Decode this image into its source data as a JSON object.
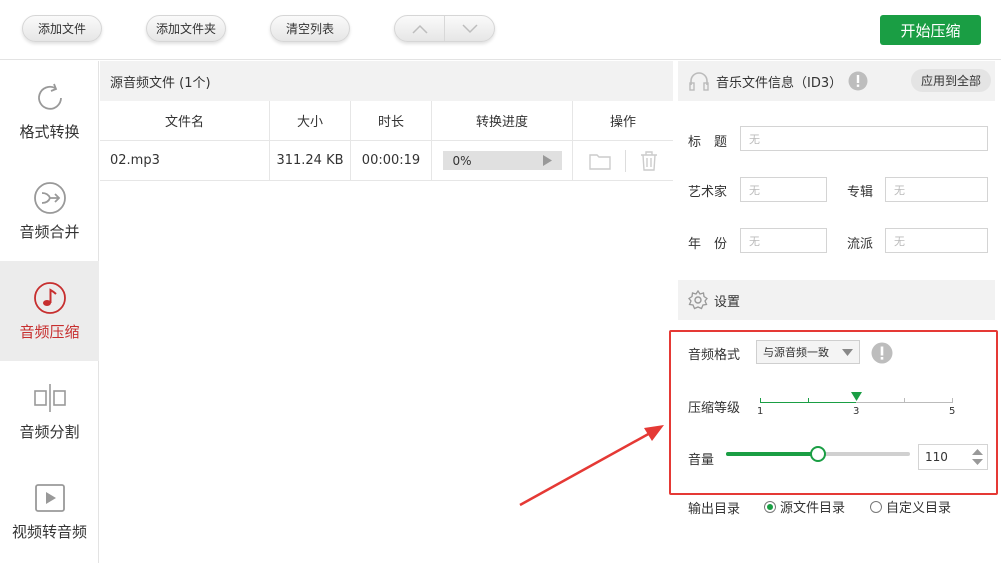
{
  "toolbar": {
    "add_file": "添加文件",
    "add_folder": "添加文件夹",
    "clear_list": "清空列表",
    "start": "开始压缩"
  },
  "sidebar": {
    "items": [
      {
        "label": "格式转换",
        "icon": "refresh-icon"
      },
      {
        "label": "音频合并",
        "icon": "merge-icon"
      },
      {
        "label": "音频压缩",
        "icon": "music-note-icon",
        "active": true
      },
      {
        "label": "音频分割",
        "icon": "split-icon"
      },
      {
        "label": "视频转音频",
        "icon": "video-play-icon"
      }
    ]
  },
  "files": {
    "header": "源音频文件 (1个)",
    "columns": [
      "文件名",
      "大小",
      "时长",
      "转换进度",
      "操作"
    ],
    "rows": [
      {
        "name": "02.mp3",
        "size": "311.24 KB",
        "duration": "00:00:19",
        "progress": "0%"
      }
    ]
  },
  "id3": {
    "title": "音乐文件信息（ID3）",
    "apply_all": "应用到全部",
    "fields": {
      "title_label": "标　题",
      "artist_label": "艺术家",
      "album_label": "专辑",
      "year_label": "年　份",
      "genre_label": "流派",
      "empty": "无"
    }
  },
  "settings": {
    "title": "设置",
    "format_label": "音频格式",
    "format_value": "与源音频一致",
    "level_label": "压缩等级",
    "level_ticks": [
      "1",
      "3",
      "5"
    ],
    "level_value": 3,
    "volume_label": "音量",
    "volume_value": "110",
    "volume_fraction": 0.5,
    "output_label": "输出目录",
    "output_options": [
      "源文件目录",
      "自定义目录"
    ],
    "output_selected": 0
  },
  "colors": {
    "accent": "#1a9e44",
    "active": "#c72f2f",
    "highlight": "#e53935"
  }
}
